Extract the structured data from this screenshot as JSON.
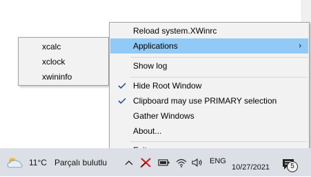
{
  "menu": {
    "items": [
      {
        "label": "Reload system.XWinrc"
      },
      {
        "label": "Applications",
        "arrow": "›"
      },
      {
        "label": "Show log"
      },
      {
        "label": "Hide Root Window",
        "checked": true
      },
      {
        "label": "Clipboard may use PRIMARY selection",
        "checked": true
      },
      {
        "label": "Gather Windows"
      },
      {
        "label": "About..."
      },
      {
        "label": "Exit..."
      }
    ]
  },
  "submenu": {
    "items": [
      {
        "label": "xcalc"
      },
      {
        "label": "xclock"
      },
      {
        "label": "xwininfo"
      }
    ]
  },
  "taskbar": {
    "temperature": "11°C",
    "weather_desc": "Parçalı bulutlu",
    "language": "ENG",
    "date": "10/27/2021",
    "notification_count": "5"
  },
  "icons": {
    "weather": "partly-cloudy-icon",
    "tray_chevron": "chevron-up-icon",
    "x_server": "x-server-icon",
    "battery": "battery-icon",
    "wifi": "wifi-icon",
    "volume": "volume-icon",
    "notifications": "notification-icon",
    "check": "checkmark-icon"
  },
  "colors": {
    "highlight": "#91c9f7",
    "menu_bg": "#f2f2f2",
    "check": "#1e4d8c",
    "taskbar_bg": "#dcdfe5"
  }
}
